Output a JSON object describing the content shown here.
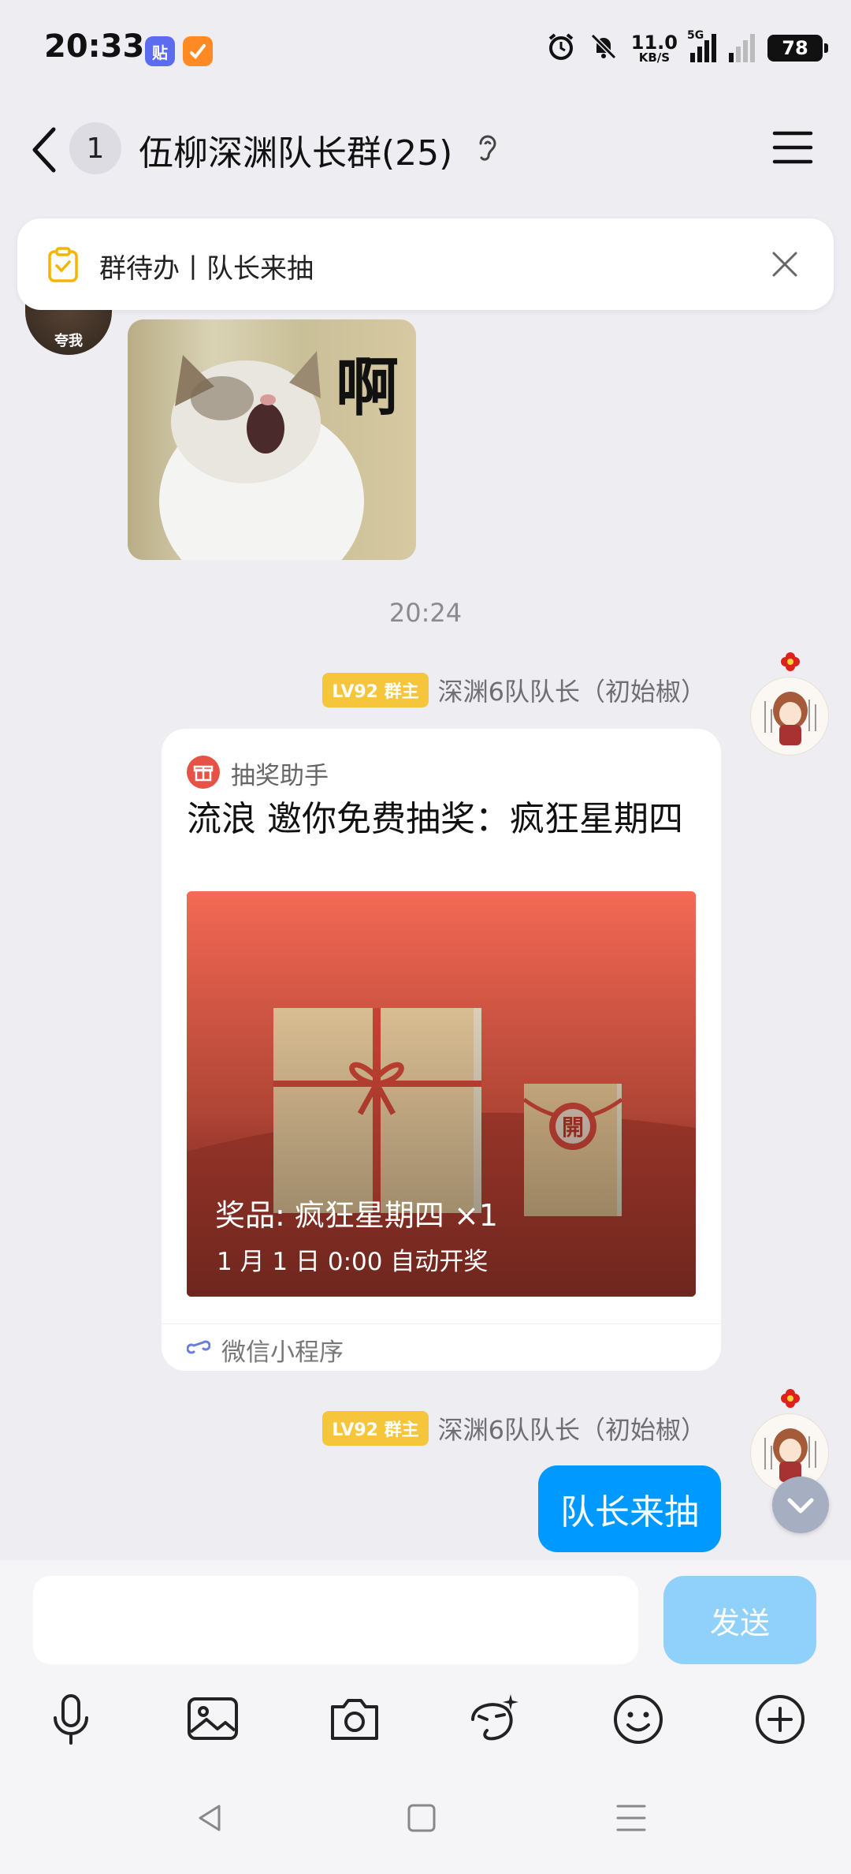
{
  "status_bar": {
    "time": "20:33",
    "app_icon_1": "贴",
    "network_speed_value": "11.0",
    "network_speed_unit": "KB/S",
    "network_type": "5G",
    "battery": "78",
    "icons": [
      "alarm-icon",
      "mute-bell-icon",
      "signal-icon",
      "signal-icon"
    ]
  },
  "header": {
    "unread_count": "1",
    "title": "伍柳深渊队长群(25)"
  },
  "todo_banner": {
    "text": "群待办丨队长来抽"
  },
  "messages": {
    "left_avatar_label": "夸我",
    "sticker_text": "啊",
    "timestamp": "20:24",
    "sender_level": "LV92 群主",
    "sender_name": "深渊6队队长（初始椒）",
    "card": {
      "app_name": "抽奖助手",
      "title": "流浪 邀你免费抽奖：疯狂星期四",
      "prize": "奖品: 疯狂星期四 ×1",
      "draw_time": "1 月 1 日 0:00 自动开奖",
      "seal_char": "開",
      "footer": "微信小程序"
    },
    "sender_level_2": "LV92 群主",
    "sender_name_2": "深渊6队队长（初始椒）",
    "text_bubble": "队长来抽"
  },
  "input_bar": {
    "placeholder": "",
    "send_label": "发送"
  },
  "colors": {
    "accent": "#0099FF",
    "send_disabled": "#8FD1FA",
    "level_badge": "#F5C53B",
    "card_red": "#F26B55"
  }
}
